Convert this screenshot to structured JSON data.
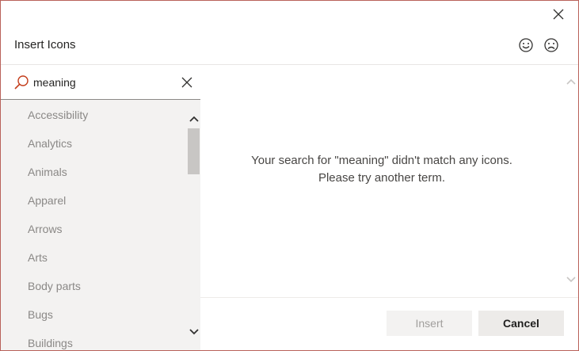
{
  "dialog": {
    "title": "Insert Icons",
    "accent_color": "#c43e1c"
  },
  "search": {
    "value": "meaning",
    "placeholder": ""
  },
  "categories": [
    "Accessibility",
    "Analytics",
    "Animals",
    "Apparel",
    "Arrows",
    "Arts",
    "Body parts",
    "Bugs",
    "Buildings"
  ],
  "message": {
    "line1": "Your search for \"meaning\" didn't match any icons.",
    "line2": "Please try another term."
  },
  "buttons": {
    "insert_label": "Insert",
    "cancel_label": "Cancel"
  }
}
